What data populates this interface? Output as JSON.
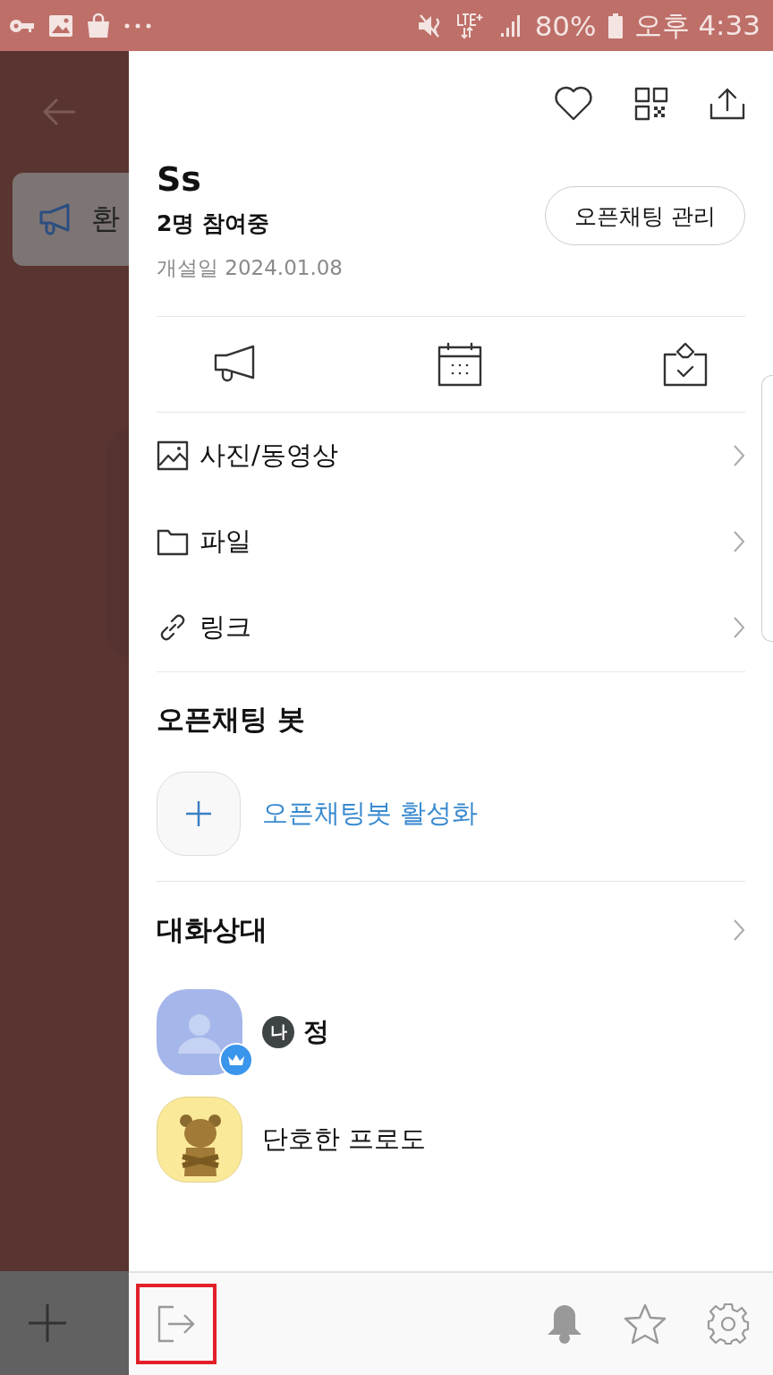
{
  "status_bar": {
    "battery": "80%",
    "time": "오후 4:33"
  },
  "background": {
    "notice": "환"
  },
  "drawer": {
    "title": "Ss",
    "members_count": "2명 참여중",
    "created": "개설일 2024.01.08",
    "manage_button": "오픈채팅 관리",
    "menu": [
      {
        "kind": "media",
        "label": "사진/동영상"
      },
      {
        "kind": "file",
        "label": "파일"
      },
      {
        "kind": "link",
        "label": "링크"
      }
    ],
    "bot": {
      "heading": "오픈채팅 봇",
      "action": "오픈채팅봇 활성화"
    },
    "participants": {
      "heading": "대화상대",
      "members": [
        {
          "kind": "default",
          "host": true,
          "me_badge": "나",
          "name": "정"
        },
        {
          "kind": "character",
          "host": false,
          "name": "단호한 프로도"
        }
      ]
    },
    "bottom_bar": {
      "exit_highlighted": true
    }
  }
}
